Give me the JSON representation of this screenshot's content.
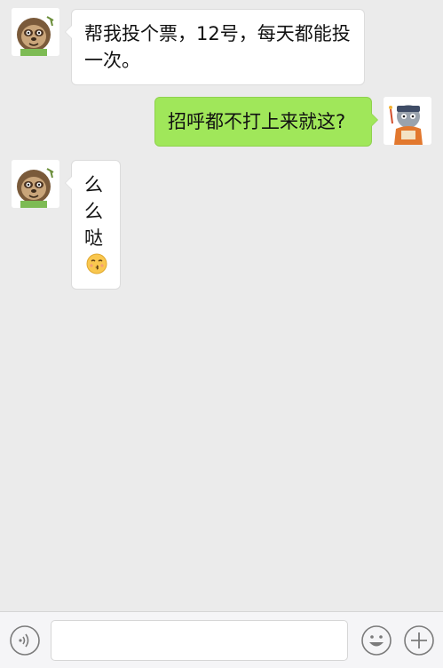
{
  "chat": {
    "messages": [
      {
        "sender": "contact",
        "text": "帮我投个票，12号，每天都能投一次。"
      },
      {
        "sender": "me",
        "text": "招呼都不打上来就这?"
      },
      {
        "sender": "contact",
        "text": "么么哒",
        "emoji": "kissing-face-emoji"
      }
    ]
  },
  "composer": {
    "voice_icon": "voice-icon",
    "emoji_icon": "smiley-icon",
    "plus_icon": "plus-icon",
    "input_value": ""
  },
  "colors": {
    "background": "#ebebeb",
    "bubble_incoming": "#ffffff",
    "bubble_outgoing": "#a0e75a",
    "toolbar": "#f5f5f7"
  }
}
